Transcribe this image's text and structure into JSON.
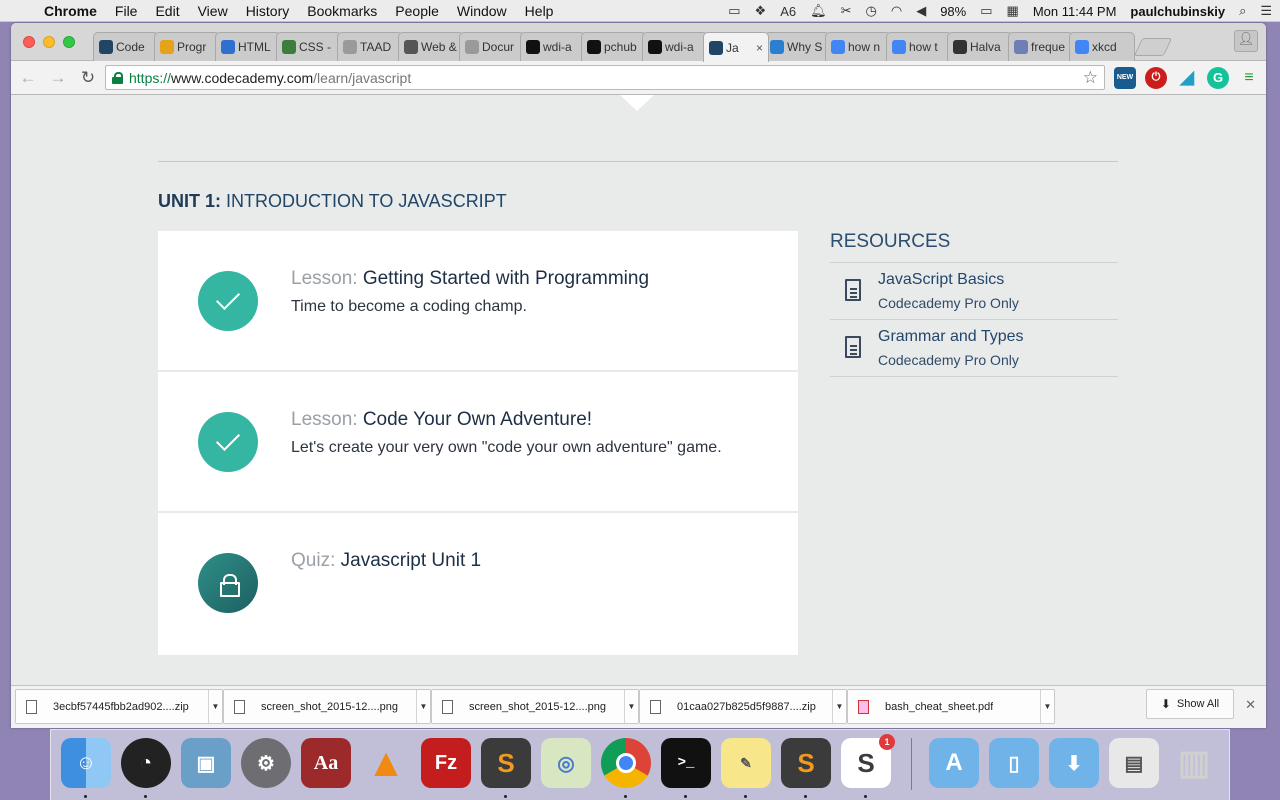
{
  "menubar": {
    "app": "Chrome",
    "menus": [
      "File",
      "Edit",
      "View",
      "History",
      "Bookmarks",
      "People",
      "Window",
      "Help"
    ],
    "adobe_count": "6",
    "battery": "98%",
    "clock": "Mon 11:44 PM",
    "user": "paulchubinskiy"
  },
  "tabs": [
    {
      "label": "Code",
      "icon": "codecademy-old-icon"
    },
    {
      "label": "Progr",
      "icon": "ejs-icon"
    },
    {
      "label": "HTML",
      "icon": "code-icon"
    },
    {
      "label": "CSS -",
      "icon": "css-icon"
    },
    {
      "label": "TAAD",
      "icon": "doc-icon"
    },
    {
      "label": "Web &",
      "icon": "web-icon"
    },
    {
      "label": "Docur",
      "icon": "doc-icon"
    },
    {
      "label": "wdi-a",
      "icon": "github-icon"
    },
    {
      "label": "pchub",
      "icon": "github-icon"
    },
    {
      "label": "wdi-a",
      "icon": "github-icon"
    },
    {
      "label": "Ja",
      "icon": "codecademy-icon",
      "active": true
    },
    {
      "label": "Why S",
      "icon": "infoq-icon"
    },
    {
      "label": "how n",
      "icon": "google-icon"
    },
    {
      "label": "how t",
      "icon": "google-icon"
    },
    {
      "label": "Halva",
      "icon": "wikipedia-icon"
    },
    {
      "label": "freque",
      "icon": "php-icon"
    },
    {
      "label": "xkcd",
      "icon": "google-icon"
    }
  ],
  "toolbar": {
    "url_scheme": "https://",
    "url_host": "www.codecademy.com",
    "url_path": "/learn/javascript",
    "ext_new_badge": "NEW"
  },
  "page": {
    "unit_label": "UNIT 1:",
    "unit_title": " INTRODUCTION TO JAVASCRIPT",
    "cards": [
      {
        "kind": "Lesson: ",
        "title": "Getting Started with Programming",
        "desc": "Time to become a coding champ.",
        "status": "complete"
      },
      {
        "kind": "Lesson: ",
        "title": "Code Your Own Adventure!",
        "desc": "Let's create your very own \"code your own adventure\" game.",
        "status": "complete"
      },
      {
        "kind": "Quiz: ",
        "title": "Javascript Unit 1",
        "desc": "",
        "status": "locked"
      }
    ],
    "resources_heading": "RESOURCES",
    "resources": [
      {
        "title": "JavaScript Basics",
        "sub": "Codecademy Pro Only"
      },
      {
        "title": "Grammar and Types",
        "sub": "Codecademy Pro Only"
      }
    ]
  },
  "downloads": {
    "items": [
      {
        "name": "3ecbf57445fbb2ad902....zip",
        "type": "zip"
      },
      {
        "name": "screen_shot_2015-12....png",
        "type": "png"
      },
      {
        "name": "screen_shot_2015-12....png",
        "type": "png"
      },
      {
        "name": "01caa027b825d5f9887....zip",
        "type": "zip"
      },
      {
        "name": "bash_cheat_sheet.pdf",
        "type": "pdf"
      }
    ],
    "show_all": "Show All"
  },
  "dock": {
    "apps": [
      "Finder",
      "Dashboard",
      "Preview",
      "System Preferences",
      "Dictionary",
      "VLC",
      "FileZilla",
      "Sublime Text",
      "Maps",
      "Google Chrome",
      "Terminal",
      "Stickies",
      "Sublime Text",
      "Slack"
    ],
    "folders": [
      "Applications",
      "Documents",
      "Downloads",
      "Recent",
      "Trash"
    ],
    "dictionary_label": "Aa",
    "filezilla_label": "Fz",
    "sublime_label": "S",
    "terminal_label": ">_",
    "slack_label": "S",
    "slack_badge": "1",
    "colors": {
      "accent": "#35b6a2",
      "locked": "#1d5f62",
      "link": "#23466b"
    }
  }
}
